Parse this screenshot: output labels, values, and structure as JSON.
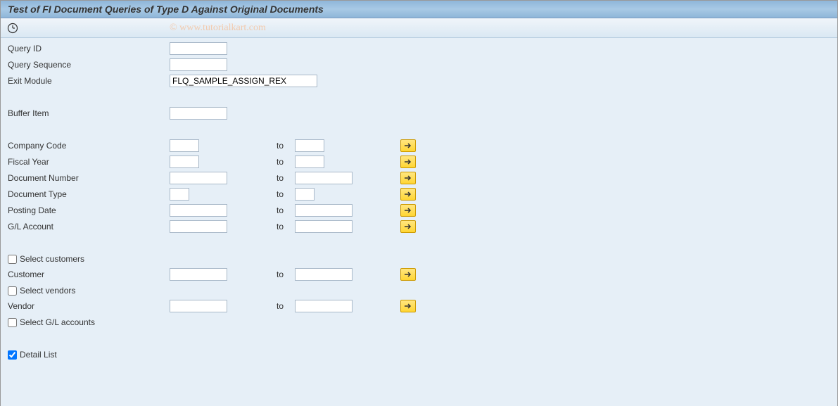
{
  "title": "Test of FI Document Queries of Type D Against Original Documents",
  "watermark": "© www.tutorialkart.com",
  "fields": {
    "query_id": {
      "label": "Query ID",
      "value": ""
    },
    "query_sequence": {
      "label": "Query Sequence",
      "value": ""
    },
    "exit_module": {
      "label": "Exit Module",
      "value": "FLQ_SAMPLE_ASSIGN_REX"
    },
    "buffer_item": {
      "label": "Buffer Item",
      "value": ""
    }
  },
  "ranges": {
    "company_code": {
      "label": "Company Code",
      "from": "",
      "to": ""
    },
    "fiscal_year": {
      "label": "Fiscal Year",
      "from": "",
      "to": ""
    },
    "document_number": {
      "label": "Document Number",
      "from": "",
      "to": ""
    },
    "document_type": {
      "label": "Document Type",
      "from": "",
      "to": ""
    },
    "posting_date": {
      "label": "Posting Date",
      "from": "",
      "to": ""
    },
    "gl_account": {
      "label": "G/L Account",
      "from": "",
      "to": ""
    },
    "customer": {
      "label": "Customer",
      "from": "",
      "to": ""
    },
    "vendor": {
      "label": "Vendor",
      "from": "",
      "to": ""
    }
  },
  "to_label": "to",
  "checkboxes": {
    "select_customers": {
      "label": "Select customers",
      "checked": false
    },
    "select_vendors": {
      "label": "Select vendors",
      "checked": false
    },
    "select_gl_accounts": {
      "label": "Select G/L accounts",
      "checked": false
    },
    "detail_list": {
      "label": "Detail List",
      "checked": true
    }
  }
}
